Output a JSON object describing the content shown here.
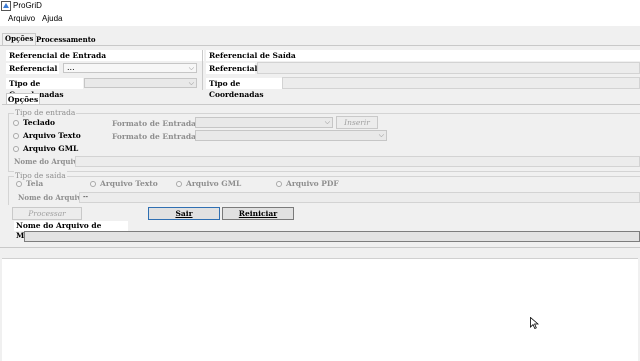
{
  "window": {
    "title": "ProGriD"
  },
  "menu": {
    "file": "Arquivo",
    "help": "Ajuda"
  },
  "tabs": {
    "options": "Opções",
    "processing": "Processamento"
  },
  "input_ref": {
    "header": "Referencial de Entrada",
    "ref_label": "Referencial",
    "ref_value": "...",
    "coord_label": "Tipo de Coordenadas"
  },
  "output_ref": {
    "header": "Referencial de Saída",
    "ref_label": "Referencial",
    "coord_label": "Tipo de Coordenadas"
  },
  "options_tab": "Opções",
  "input_type": {
    "legend": "Tipo de entrada",
    "keyboard": "Teclado",
    "text_file": "Arquivo Texto",
    "gml_file": "Arquivo GML",
    "input_format_label_1": "Formato de Entrada",
    "input_format_label_2": "Formato de Entrada",
    "insert_button": "Inserir",
    "file_name_label": "Nome do Arquivo"
  },
  "output_type": {
    "legend": "Tipo de saída",
    "screen": "Tela",
    "text_file": "Arquivo Texto",
    "gml_file": "Arquivo GML",
    "pdf_file": "Arquivo PDF",
    "file_name_label": "Nome do Arquivo",
    "file_name_value": "--"
  },
  "buttons": {
    "process": "Processar",
    "exit": "Sair",
    "restart": "Reiniciar"
  },
  "message_file": {
    "label": "Nome do Arquivo de Mensagem"
  }
}
